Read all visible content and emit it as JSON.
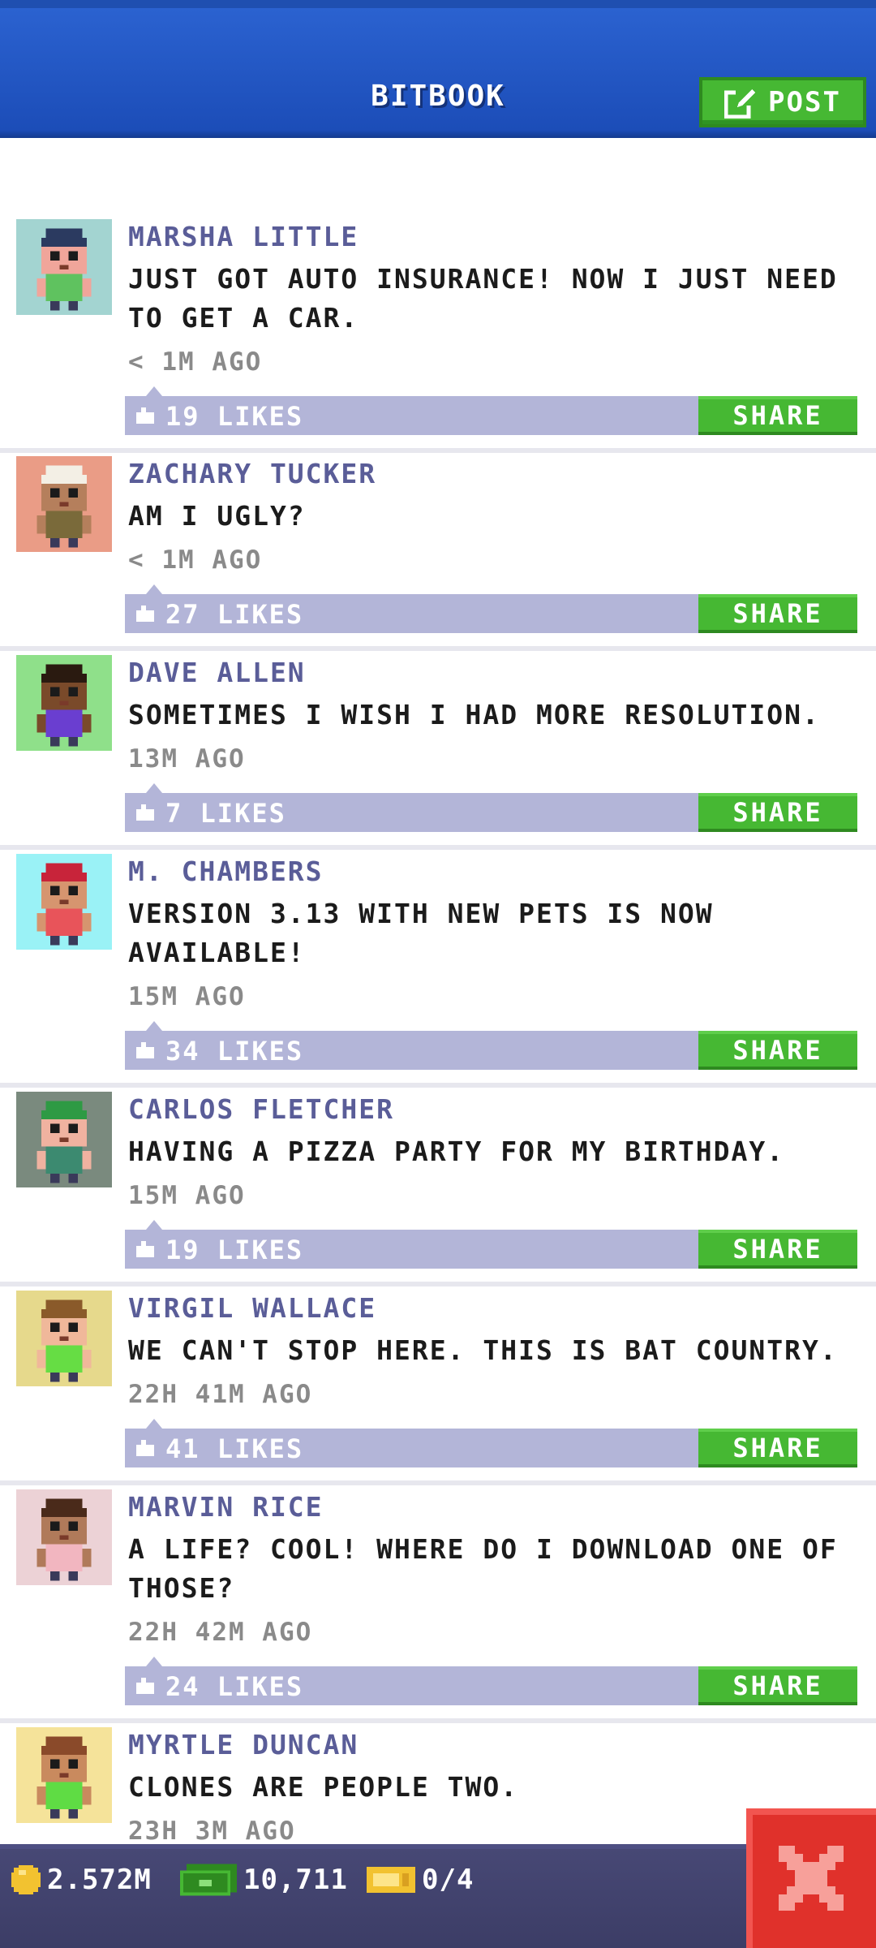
{
  "header": {
    "title": "BITBOOK",
    "post_label": "POST"
  },
  "posts": [
    {
      "name": "MARSHA LITTLE",
      "message": "JUST GOT AUTO INSURANCE! NOW I JUST NEED TO GET A CAR.",
      "time": "< 1M AGO",
      "likes": "19 LIKES",
      "share_label": "SHARE",
      "avatar_bg": "#a3d4d1",
      "skin": "#f0a59a",
      "hair": "#2b3a60",
      "shirt": "#5fc25f"
    },
    {
      "name": "ZACHARY TUCKER",
      "message": "AM I UGLY?",
      "time": "< 1M AGO",
      "likes": "27 LIKES",
      "share_label": "SHARE",
      "avatar_bg": "#ea9c86",
      "skin": "#b57f5c",
      "hair": "#f3efe5",
      "shirt": "#7a6a3a"
    },
    {
      "name": "DAVE ALLEN",
      "message": "SOMETIMES I WISH I HAD MORE RESOLUTION.",
      "time": "13M AGO",
      "likes": "7 LIKES",
      "share_label": "SHARE",
      "avatar_bg": "#8fe08a",
      "skin": "#7a4a2a",
      "hair": "#2a1a10",
      "shirt": "#6a3ed0"
    },
    {
      "name": "M. CHAMBERS",
      "message": "VERSION 3.13 WITH NEW PETS IS NOW AVAILABLE!",
      "time": "15M AGO",
      "likes": "34 LIKES",
      "share_label": "SHARE",
      "avatar_bg": "#9af2f6",
      "skin": "#d6956f",
      "hair": "#c8243a",
      "shirt": "#e8545a"
    },
    {
      "name": "CARLOS FLETCHER",
      "message": "HAVING A PIZZA PARTY FOR MY BIRTHDAY.",
      "time": "15M AGO",
      "likes": "19 LIKES",
      "share_label": "SHARE",
      "avatar_bg": "#7a8a7e",
      "skin": "#f0b2a0",
      "hair": "#2e9a44",
      "shirt": "#3c8a70"
    },
    {
      "name": "VIRGIL WALLACE",
      "message": "WE CAN'T STOP HERE. THIS IS BAT COUNTRY.",
      "time": "22H 41M AGO",
      "likes": "41 LIKES",
      "share_label": "SHARE",
      "avatar_bg": "#e6d98c",
      "skin": "#f0b89a",
      "hair": "#8a5a2a",
      "shirt": "#66dd44"
    },
    {
      "name": "MARVIN RICE",
      "message": "A LIFE? COOL! WHERE DO I DOWNLOAD ONE OF THOSE?",
      "time": "22H 42M AGO",
      "likes": "24 LIKES",
      "share_label": "SHARE",
      "avatar_bg": "#ecd2d6",
      "skin": "#b07a5a",
      "hair": "#4a2a1a",
      "shirt": "#f2b6c0"
    },
    {
      "name": "MYRTLE DUNCAN",
      "message": "CLONES ARE PEOPLE TWO.",
      "time": "23H 3M AGO",
      "likes": "",
      "share_label": "",
      "avatar_bg": "#f5e39a",
      "skin": "#c98a5e",
      "hair": "#8a4a2a",
      "shirt": "#5fdc44"
    }
  ],
  "footer": {
    "coins": "2.572M",
    "bux": "10,711",
    "tickets": "0/4"
  },
  "colors": {
    "accent_green": "#46b833",
    "header_blue": "#2b62d0",
    "name_purple": "#5a5d98",
    "likes_bar": "#b3b5d8",
    "close_red": "#e0312b"
  }
}
